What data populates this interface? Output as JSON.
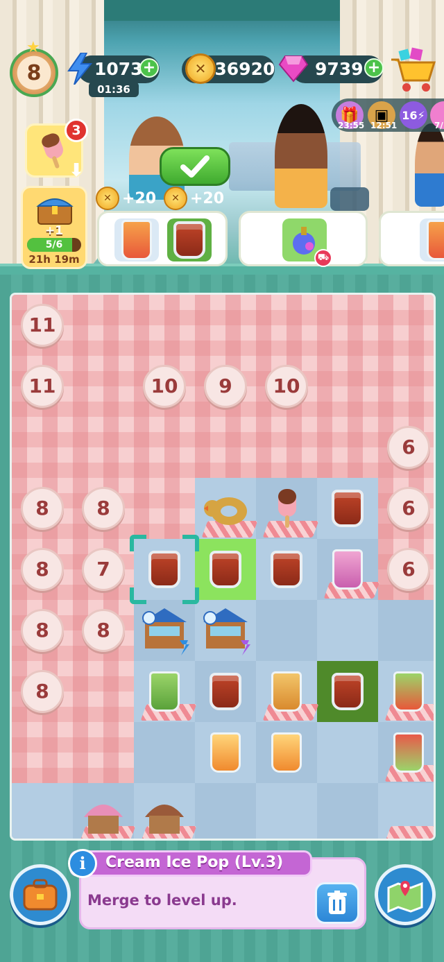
{
  "player": {
    "level": "8"
  },
  "resources": {
    "energy": "1073",
    "energy_timer": "01:36",
    "coins": "236920",
    "gems": "9739"
  },
  "events": [
    {
      "icon": "gift-event-icon",
      "time": "23:55"
    },
    {
      "icon": "photo-frame-event-icon",
      "time": "12:51"
    },
    {
      "icon": "energy-boost-event-icon",
      "label": "16"
    },
    {
      "icon": "candy-event-icon",
      "time": "7/"
    }
  ],
  "orders_widget": {
    "popsicle_badge": "3",
    "chest_bonus": "+1",
    "chest_progress": "5/6",
    "chest_progress_fraction": 0.83,
    "chest_timer": "21h 19m"
  },
  "order_rewards": [
    "+20",
    "+20"
  ],
  "board": {
    "locks": [
      {
        "row": 0,
        "col": 0,
        "value": "11"
      },
      {
        "row": 1,
        "col": 0,
        "value": "11"
      },
      {
        "row": 1,
        "col": 2,
        "value": "10"
      },
      {
        "row": 1,
        "col": 3,
        "value": "9"
      },
      {
        "row": 1,
        "col": 4,
        "value": "10"
      },
      {
        "row": 2,
        "col": 6,
        "value": "6"
      },
      {
        "row": 3,
        "col": 0,
        "value": "8"
      },
      {
        "row": 3,
        "col": 1,
        "value": "8"
      },
      {
        "row": 3,
        "col": 6,
        "value": "6"
      },
      {
        "row": 4,
        "col": 0,
        "value": "8"
      },
      {
        "row": 4,
        "col": 1,
        "value": "7"
      },
      {
        "row": 4,
        "col": 6,
        "value": "6"
      },
      {
        "row": 5,
        "col": 0,
        "value": "8"
      },
      {
        "row": 5,
        "col": 1,
        "value": "8"
      },
      {
        "row": 6,
        "col": 0,
        "value": "8"
      }
    ]
  },
  "info": {
    "title": "Cream Ice Pop (Lv.3)",
    "description": "Merge to level up."
  },
  "colors": {
    "accent_green": "#4cc24a",
    "info_purple": "#c466d4",
    "board_pink": "#f2b7b9",
    "board_blue": "#b3cde3"
  }
}
